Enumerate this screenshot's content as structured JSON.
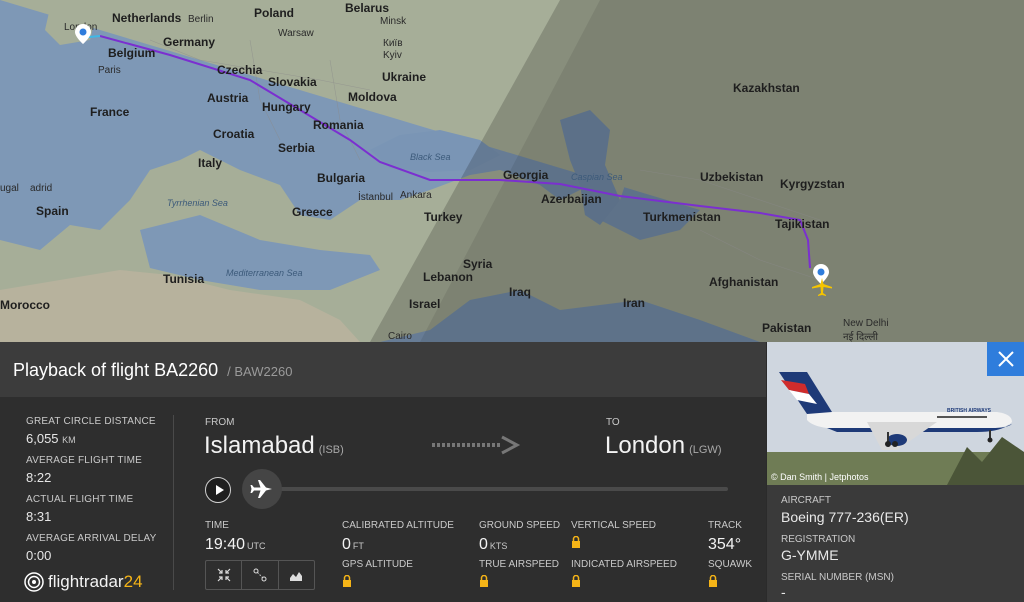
{
  "map": {
    "countries": {
      "netherlands": "Netherlands",
      "poland": "Poland",
      "belarus": "Belarus",
      "belgium": "Belgium",
      "germany": "Germany",
      "ukraine": "Ukraine",
      "czechia": "Czechia",
      "slovakia": "Slovakia",
      "moldova": "Moldova",
      "austria": "Austria",
      "hungary": "Hungary",
      "romania": "Romania",
      "france": "France",
      "croatia": "Croatia",
      "serbia": "Serbia",
      "kazakhstan": "Kazakhstan",
      "italy": "Italy",
      "bulgaria": "Bulgaria",
      "georgia": "Georgia",
      "uzbekistan": "Uzbekistan",
      "kyrgyzstan": "Kyrgyzstan",
      "spain": "Spain",
      "greece": "Greece",
      "turkey": "Turkey",
      "azerbaijan": "Azerbaijan",
      "turkmenistan": "Turkmenistan",
      "tajikistan": "Tajikistan",
      "tunisia": "Tunisia",
      "lebanon": "Lebanon",
      "syria": "Syria",
      "iraq": "Iraq",
      "afghanistan": "Afghanistan",
      "morocco": "Morocco",
      "israel": "Israel",
      "iran": "Iran",
      "pakistan": "Pakistan",
      "portugal_partial": "ugal"
    },
    "cities": {
      "london": "London",
      "berlin": "Berlin",
      "warsaw": "Warsaw",
      "minsk": "Minsk",
      "kyiv": "Київ",
      "kyiv_latin": "Kyiv",
      "paris": "Paris",
      "istanbul": "İstanbul",
      "ankara": "Ankara",
      "cairo": "Cairo",
      "new_delhi": "New Delhi",
      "new_delhi_hindi": "नई दिल्ली",
      "madrid_partial": "adrid"
    },
    "seas": {
      "black_sea": "Black Sea",
      "caspian_sea": "Caspian Sea",
      "tyrrhenian": "Tyrrhenian Sea",
      "mediterranean": "Mediterranean Sea"
    },
    "colors": {
      "route": "#7b2fd0",
      "land": "#a8b49a",
      "water": "#7d97b6"
    }
  },
  "header": {
    "title": "Playback of flight BA2260",
    "callsign": "/ BAW2260"
  },
  "stats": {
    "gcd_label": "GREAT CIRCLE DISTANCE",
    "gcd_value": "6,055",
    "gcd_unit": "KM",
    "avg_time_label": "AVERAGE FLIGHT TIME",
    "avg_time_value": "8:22",
    "actual_time_label": "ACTUAL FLIGHT TIME",
    "actual_time_value": "8:31",
    "delay_label": "AVERAGE ARRIVAL DELAY",
    "delay_value": "0:00"
  },
  "route": {
    "from_label": "FROM",
    "from_city": "Islamabad",
    "from_code": "(ISB)",
    "to_label": "TO",
    "to_city": "London",
    "to_code": "(LGW)"
  },
  "metrics": {
    "time_label": "TIME",
    "time_value": "19:40",
    "time_unit": "UTC",
    "cal_alt_label": "CALIBRATED ALTITUDE",
    "cal_alt_value": "0",
    "cal_alt_unit": "FT",
    "gps_alt_label": "GPS ALTITUDE",
    "ground_speed_label": "GROUND SPEED",
    "ground_speed_value": "0",
    "ground_speed_unit": "KTS",
    "true_airspeed_label": "TRUE AIRSPEED",
    "vertical_speed_label": "VERTICAL SPEED",
    "indicated_airspeed_label": "INDICATED AIRSPEED",
    "track_label": "TRACK",
    "track_value": "354°",
    "squawk_label": "SQUAWK"
  },
  "logo": {
    "text_main": "flightradar",
    "text_num": "24"
  },
  "aircraft": {
    "photo_credit": "© Dan Smith | Jetphotos",
    "livery_text": "BRITISH AIRWAYS",
    "aircraft_label": "AIRCRAFT",
    "aircraft_value": "Boeing 777-236(ER)",
    "registration_label": "REGISTRATION",
    "registration_value": "G-YMME",
    "serial_label": "SERIAL NUMBER (MSN)",
    "serial_value": "-"
  }
}
